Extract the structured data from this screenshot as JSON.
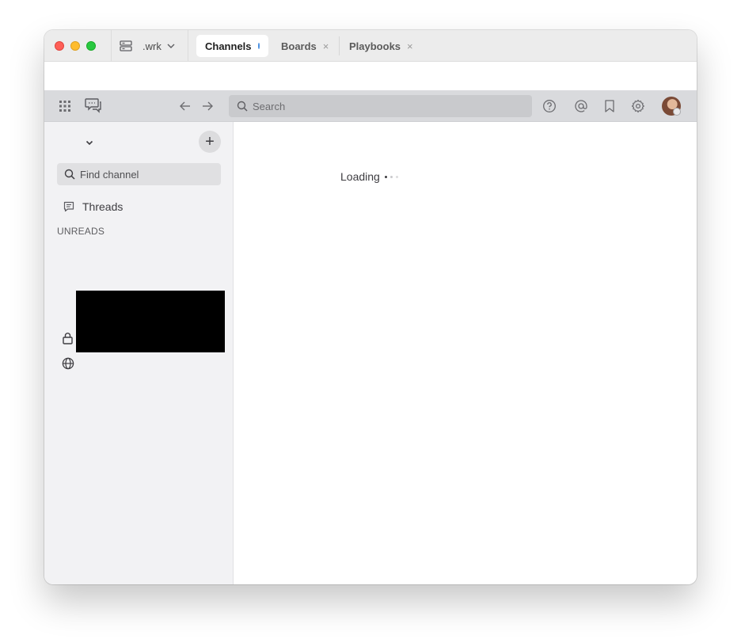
{
  "window": {
    "server": {
      "name": ".wrk"
    },
    "tabs": [
      {
        "label": "Channels",
        "active": true,
        "indicator": "unread-dot"
      },
      {
        "label": "Boards",
        "active": false,
        "close": "×"
      },
      {
        "label": "Playbooks",
        "active": false,
        "close": "×"
      }
    ]
  },
  "header": {
    "search_placeholder": "Search",
    "icons": [
      "app-grid-icon",
      "chat-bubbles-icon",
      "back-arrow-icon",
      "forward-arrow-icon",
      "help-icon",
      "mentions-icon",
      "saved-bookmark-icon",
      "settings-gear-icon"
    ]
  },
  "sidebar": {
    "add_label": "+",
    "find_channel": "Find channel",
    "threads_label": "Threads",
    "unreads_label": "UNREADS",
    "channel_icons": [
      "lock-icon",
      "globe-icon"
    ]
  },
  "main": {
    "loading_text": "Loading"
  },
  "colors": {
    "tab_indicator": "#4a90e2",
    "sidebar_bg": "#f2f2f4",
    "header_bg": "#d9dadd"
  }
}
